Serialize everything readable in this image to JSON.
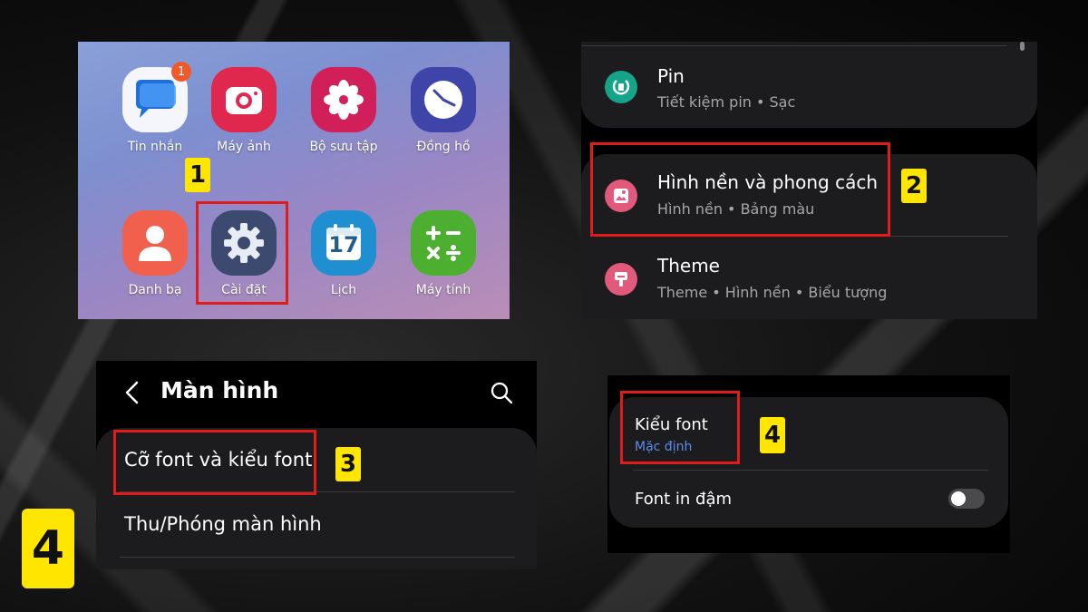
{
  "panel1": {
    "apps": [
      {
        "label": "Tin nhắn",
        "icon": "messages-icon",
        "color": "#ffffff",
        "badge": "1"
      },
      {
        "label": "Máy ảnh",
        "icon": "camera-icon",
        "color": "#e0284e"
      },
      {
        "label": "Bộ sưu tập",
        "icon": "gallery-flower-icon",
        "color": "#d11f5a"
      },
      {
        "label": "Đồng hồ",
        "icon": "clock-icon",
        "color": "#3f45a8"
      },
      {
        "label": "Danh bạ",
        "icon": "contacts-icon",
        "color": "#f0604c"
      },
      {
        "label": "Cài đặt",
        "icon": "settings-gear-icon",
        "color": "#3b4a6e"
      },
      {
        "label": "Lịch",
        "icon": "calendar-icon",
        "color": "#1f8fd1",
        "day": "17"
      },
      {
        "label": "Máy tính",
        "icon": "calculator-icon",
        "color": "#4caf2f"
      }
    ],
    "step": "1"
  },
  "panel2": {
    "rows": [
      {
        "title": "Pin",
        "subtitle": "Tiết kiệm pin  •  Sạc",
        "icon": "battery-icon"
      },
      {
        "title": "Hình nền và phong cách",
        "subtitle": "Hình nền  •  Bảng màu",
        "icon": "wallpaper-icon"
      },
      {
        "title": "Theme",
        "subtitle": "Theme  •  Hình nền  •  Biểu tượng",
        "icon": "theme-brush-icon"
      }
    ],
    "step": "2"
  },
  "panel3": {
    "header": {
      "title": "Màn hình",
      "back_icon": "back-arrow-icon",
      "search_icon": "search-icon"
    },
    "rows": [
      {
        "title": "Cỡ font và kiểu font"
      },
      {
        "title": "Thu/Phóng màn hình"
      }
    ],
    "step": "3"
  },
  "panel4": {
    "rows": [
      {
        "title": "Kiểu font",
        "subtitle": "Mặc định"
      },
      {
        "title": "Font in đậm",
        "toggle": false
      }
    ],
    "step": "4"
  },
  "big_step": "4",
  "colors": {
    "highlight": "#e01b1b",
    "badge": "#ffe600",
    "link_blue": "#5b8df0"
  }
}
